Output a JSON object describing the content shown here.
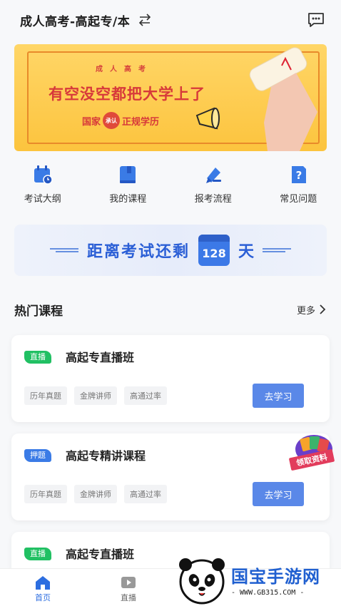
{
  "header": {
    "title": "成人高考-高起专/本",
    "switch_icon": "swap-arrows-icon",
    "message_icon": "message-icon"
  },
  "banner": {
    "small": "成人高考",
    "slogan": "有空没空都把大学上了",
    "cert_pre": "国家",
    "seal": "承认",
    "cert_post": "正规学历"
  },
  "quick_links": [
    {
      "label": "考试大纲",
      "icon": "calendar-icon"
    },
    {
      "label": "我的课程",
      "icon": "book-icon"
    },
    {
      "label": "报考流程",
      "icon": "pen-icon"
    },
    {
      "label": "常见问题",
      "icon": "question-icon"
    }
  ],
  "countdown": {
    "text": "距离考试还剩",
    "days": "128",
    "unit": "天"
  },
  "section": {
    "title": "热门课程",
    "more": "更多"
  },
  "courses": [
    {
      "badge": "直播",
      "badge_color": "#21c063",
      "name": "高起专直播班",
      "tags": [
        "历年真题",
        "金牌讲师",
        "高通过率"
      ],
      "button": "去学习"
    },
    {
      "badge": "押题",
      "badge_color": "#3a7be6",
      "name": "高起专精讲课程",
      "tags": [
        "历年真题",
        "金牌讲师",
        "高通过率"
      ],
      "button": "去学习",
      "ribbon": "领取资料"
    },
    {
      "badge": "直播",
      "badge_color": "#21c063",
      "name": "高起专直播班"
    }
  ],
  "tabbar": [
    {
      "label": "首页",
      "icon": "home-icon",
      "active": true
    },
    {
      "label": "直播",
      "icon": "play-icon",
      "active": false
    }
  ],
  "watermark": {
    "brand": "国宝手游网",
    "url": "- WWW.GB315.COM -"
  },
  "colors": {
    "accent": "#2d6ee0",
    "banner": "#fcc43e",
    "slogan": "#d7393a",
    "button": "#5a88e8"
  }
}
